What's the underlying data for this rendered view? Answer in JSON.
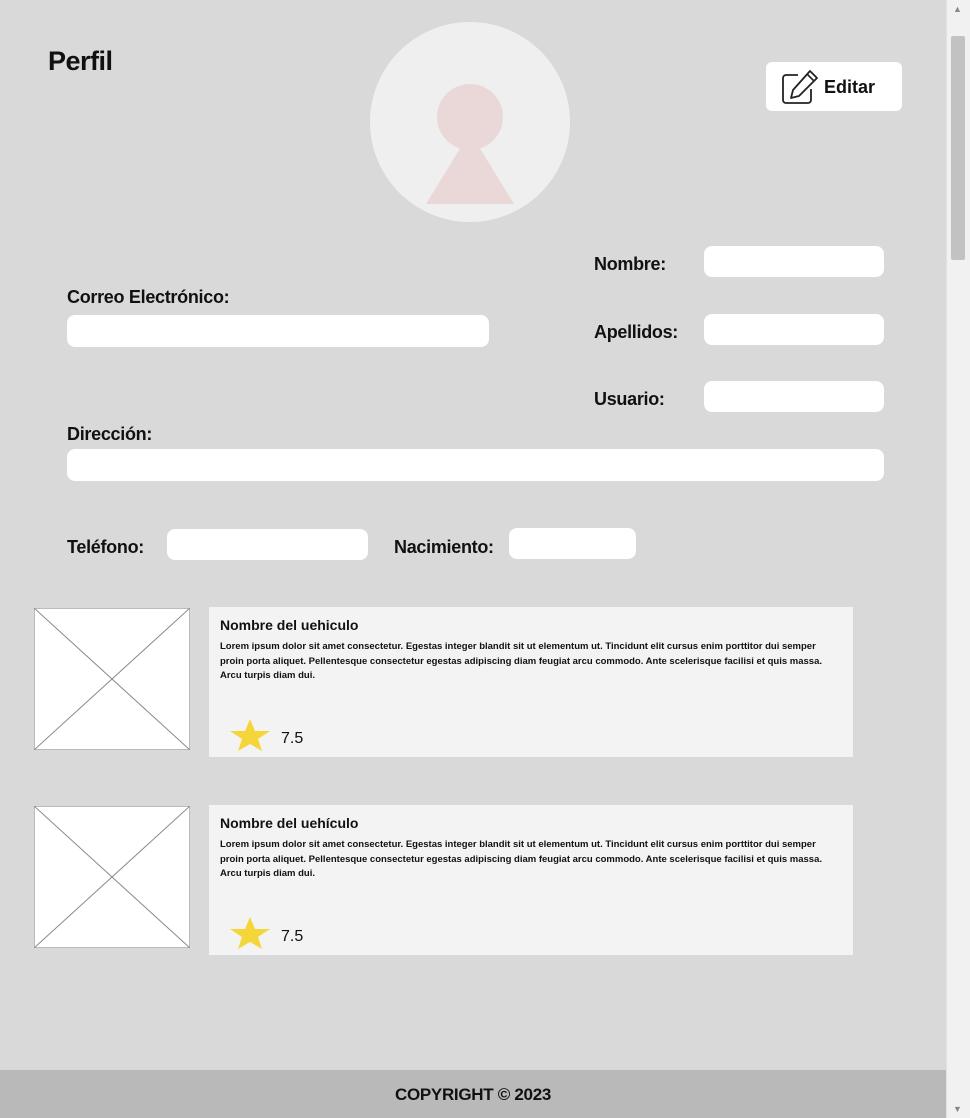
{
  "header": {
    "title": "Perfil",
    "edit_label": "Editar"
  },
  "form": {
    "email_label": "Correo Electrónico:",
    "address_label": "Dirección:",
    "name_label": "Nombre:",
    "lastname_label": "Apellidos:",
    "username_label": "Usuario:",
    "phone_label": "Teléfono:",
    "birth_label": "Nacimiento:",
    "email_value": "",
    "address_value": "",
    "name_value": "",
    "lastname_value": "",
    "username_value": "",
    "phone_value": "",
    "birth_value": ""
  },
  "vehicles": [
    {
      "title": "Nombre del uehiculo",
      "description": "Lorem ipsum dolor sit amet consectetur. Egestas integer blandit sit ut elementum ut. Tincidunt elit cursus enim porttitor dui semper proin porta aliquet. Pellentesque consectetur egestas adipiscing diam feugiat arcu commodo. Ante scelerisque facilisi et quis massa. Arcu turpis diam dui.",
      "rating": "7.5"
    },
    {
      "title": "Nombre del uehículo",
      "description": "Lorem ipsum dolor sit amet consectetur. Egestas integer blandit sit ut elementum ut. Tincidunt elit cursus enim porttitor dui semper proin porta aliquet. Pellentesque consectetur egestas adipiscing diam feugiat arcu commodo. Ante scelerisque facilisi et quis massa. Arcu turpis diam dui.",
      "rating": "7.5"
    }
  ],
  "footer": {
    "copyright": "COPYRIGHT © 2023"
  },
  "colors": {
    "background": "#d9d9d9",
    "footer": "#b9b9b9",
    "star": "#f5d63a",
    "avatar_figure": "#ead8d8"
  },
  "icons": {
    "avatar": "user-silhouette-icon",
    "edit": "pencil-square-icon",
    "rating": "star-icon",
    "image_placeholder": "image-placeholder-icon"
  }
}
